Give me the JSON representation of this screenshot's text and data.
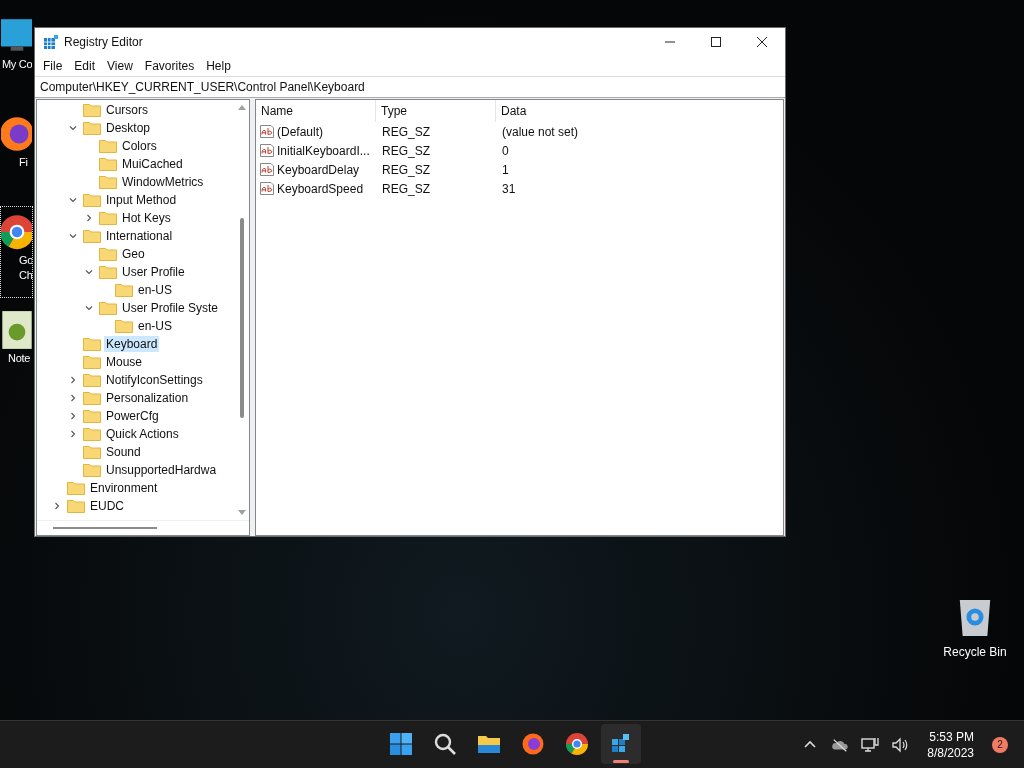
{
  "desktop_icons": [
    {
      "label": "My Co",
      "kind": "computer",
      "selected": false
    },
    {
      "label": "Fi",
      "kind": "firefox",
      "selected": false
    },
    {
      "label": "Go Ch",
      "kind": "chrome",
      "selected": true
    },
    {
      "label": "Note",
      "kind": "notepad",
      "selected": false
    }
  ],
  "recycle_bin": {
    "label": "Recycle Bin"
  },
  "window": {
    "title": "Registry Editor",
    "menu": [
      "File",
      "Edit",
      "View",
      "Favorites",
      "Help"
    ],
    "address": "Computer\\HKEY_CURRENT_USER\\Control Panel\\Keyboard"
  },
  "tree": {
    "items": [
      {
        "children": [
          {
            "label": "Cursors",
            "selected": false
          },
          {
            "label": "Desktop",
            "expanded": true,
            "selected": false,
            "children": [
              {
                "label": "Colors",
                "selected": false
              },
              {
                "label": "MuiCached",
                "selected": false
              },
              {
                "label": "WindowMetrics",
                "selected": false
              }
            ]
          },
          {
            "label": "Input Method",
            "expanded": true,
            "selected": false,
            "children": [
              {
                "label": "Hot Keys",
                "expanded": false,
                "selected": false
              }
            ]
          },
          {
            "label": "International",
            "expanded": true,
            "selected": false,
            "children": [
              {
                "label": "Geo",
                "selected": false
              },
              {
                "label": "User Profile",
                "expanded": true,
                "selected": false,
                "children": [
                  {
                    "label": "en-US",
                    "selected": false
                  }
                ]
              },
              {
                "label": "User Profile Syste",
                "expanded": true,
                "selected": false,
                "children": [
                  {
                    "label": "en-US",
                    "selected": false
                  }
                ]
              }
            ]
          },
          {
            "label": "Keyboard",
            "selected": true
          },
          {
            "label": "Mouse",
            "selected": false
          },
          {
            "label": "NotifyIconSettings",
            "expanded": false,
            "selected": false
          },
          {
            "label": "Personalization",
            "expanded": false,
            "selected": false
          },
          {
            "label": "PowerCfg",
            "expanded": false,
            "selected": false
          },
          {
            "label": "Quick Actions",
            "expanded": false,
            "selected": false
          },
          {
            "label": "Sound",
            "selected": false
          },
          {
            "label": "UnsupportedHardwa",
            "selected": false
          }
        ]
      },
      {
        "label": "Environment",
        "selected": false
      },
      {
        "label": "EUDC",
        "expanded": false,
        "selected": false
      }
    ]
  },
  "values": {
    "columns": [
      "Name",
      "Type",
      "Data"
    ],
    "rows": [
      {
        "name": "(Default)",
        "type": "REG_SZ",
        "data": "(value not set)"
      },
      {
        "name": "InitialKeyboardI...",
        "type": "REG_SZ",
        "data": "0"
      },
      {
        "name": "KeyboardDelay",
        "type": "REG_SZ",
        "data": "1"
      },
      {
        "name": "KeyboardSpeed",
        "type": "REG_SZ",
        "data": "31"
      }
    ]
  },
  "taskbar": {
    "apps": [
      {
        "kind": "start",
        "active": false
      },
      {
        "kind": "search",
        "active": false
      },
      {
        "kind": "explorer",
        "active": false
      },
      {
        "kind": "firefox",
        "active": false
      },
      {
        "kind": "chrome",
        "active": false
      },
      {
        "kind": "regedit",
        "active": true
      }
    ],
    "time": "5:53 PM",
    "date": "8/8/2023",
    "notifications": "2"
  }
}
